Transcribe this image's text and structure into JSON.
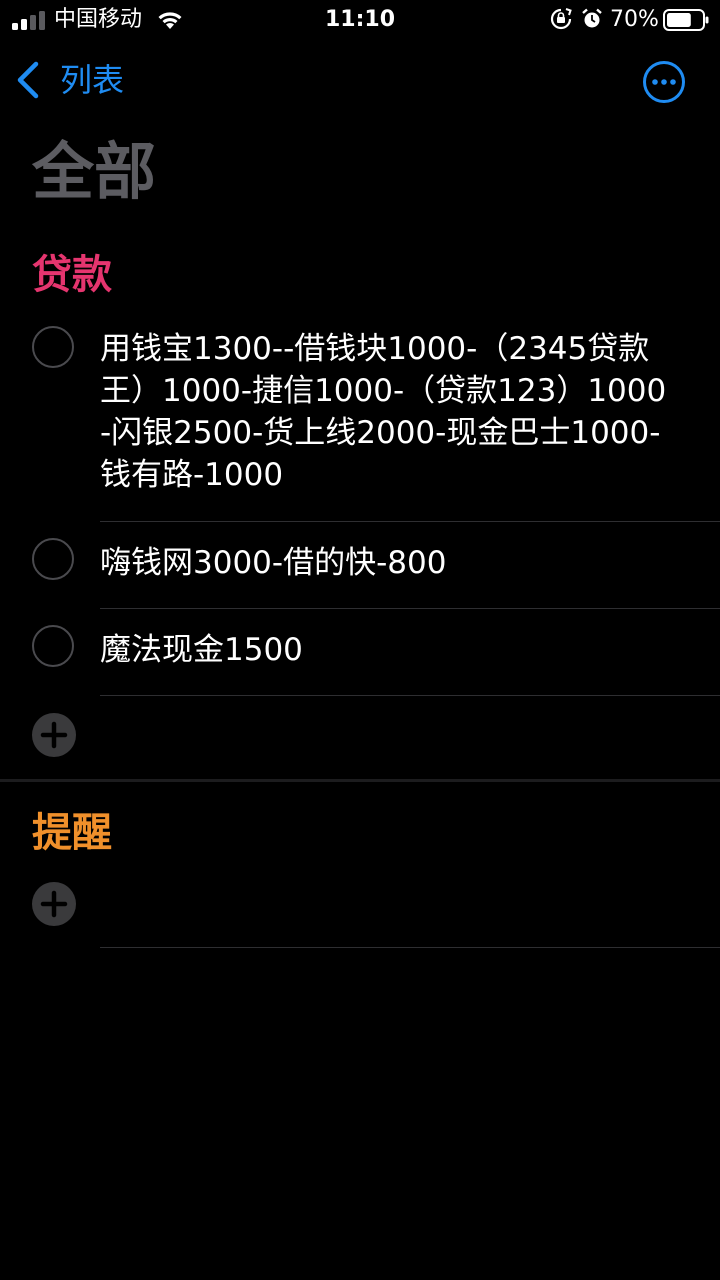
{
  "status_bar": {
    "carrier": "中国移动",
    "time": "11:10",
    "battery_percent": "70%",
    "battery_level": 0.7,
    "icons": [
      "signal-icon",
      "wifi-icon",
      "rotation-lock-icon",
      "alarm-icon",
      "battery-icon"
    ]
  },
  "nav": {
    "back_label": "列表",
    "more_icon": "ellipsis-circle-icon"
  },
  "page_title": "全部",
  "colors": {
    "accent": "#1f8cf2",
    "loans_section": "#e5356f",
    "reminders_section": "#f0902b",
    "title_gray": "#5c5c61"
  },
  "sections": [
    {
      "title": "贷款",
      "items": [
        {
          "text": "用钱宝1300--借钱块1000-（2345贷款王）1000-捷信1000-（贷款123）1000-闪银2500-货上线2000-现金巴士1000-钱有路-1000",
          "completed": false
        },
        {
          "text": "嗨钱网3000-借的快-800",
          "completed": false
        },
        {
          "text": "魔法现金1500",
          "completed": false
        }
      ]
    },
    {
      "title": "提醒",
      "items": []
    }
  ]
}
